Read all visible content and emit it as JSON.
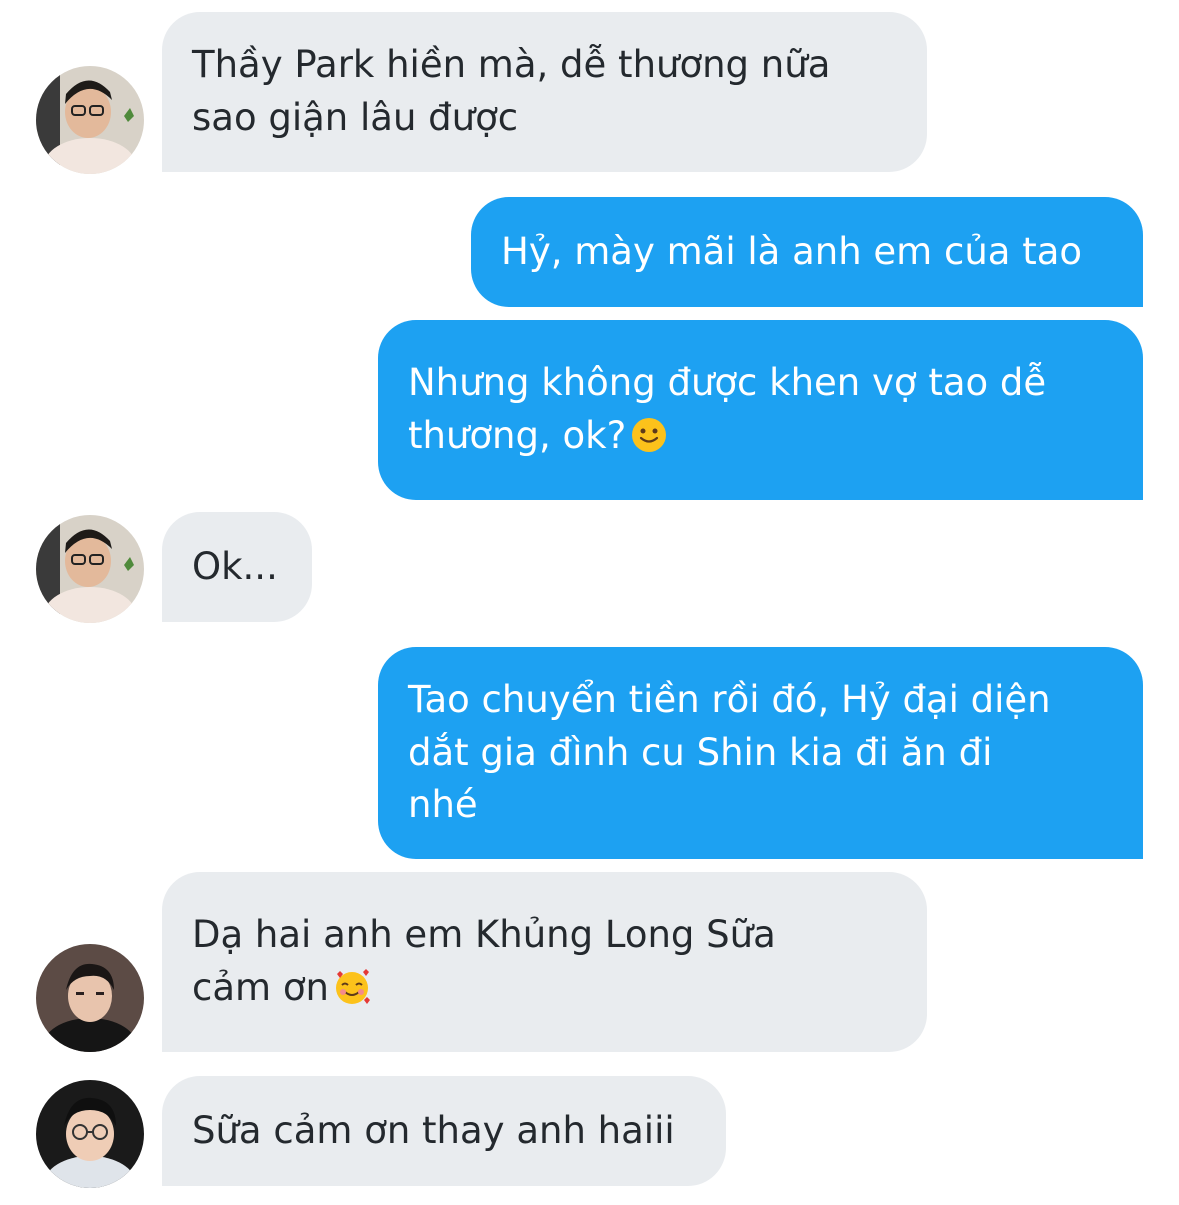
{
  "messages": [
    {
      "direction": "incoming",
      "text": "Thầy Park hiền mà, dễ thương nữa\nsao giận lâu được",
      "sender_avatar": "avatar-1"
    },
    {
      "direction": "outgoing",
      "text": "Hỷ, mày mãi là anh em của tao"
    },
    {
      "direction": "outgoing",
      "text": "Nhưng không được khen vợ tao dễ\nthương, ok?",
      "emoji": "slightly-smiling-face"
    },
    {
      "direction": "incoming",
      "text": "Ok...",
      "sender_avatar": "avatar-1"
    },
    {
      "direction": "outgoing",
      "text": "Tao chuyển tiền rồi đó, Hỷ đại diện\ndắt gia đình cu Shin kia đi ăn đi\nnhé"
    },
    {
      "direction": "incoming",
      "text": "Dạ hai anh em Khủng Long Sữa\ncảm ơn",
      "emoji": "smiling-face-with-hearts",
      "sender_avatar": "avatar-2"
    },
    {
      "direction": "incoming",
      "text": "Sữa cảm ơn thay anh haiii",
      "sender_avatar": "avatar-3"
    }
  ],
  "colors": {
    "incoming_bubble": "#e9ecef",
    "incoming_text": "#24292e",
    "outgoing_bubble": "#1da1f2",
    "outgoing_text": "#ffffff"
  }
}
